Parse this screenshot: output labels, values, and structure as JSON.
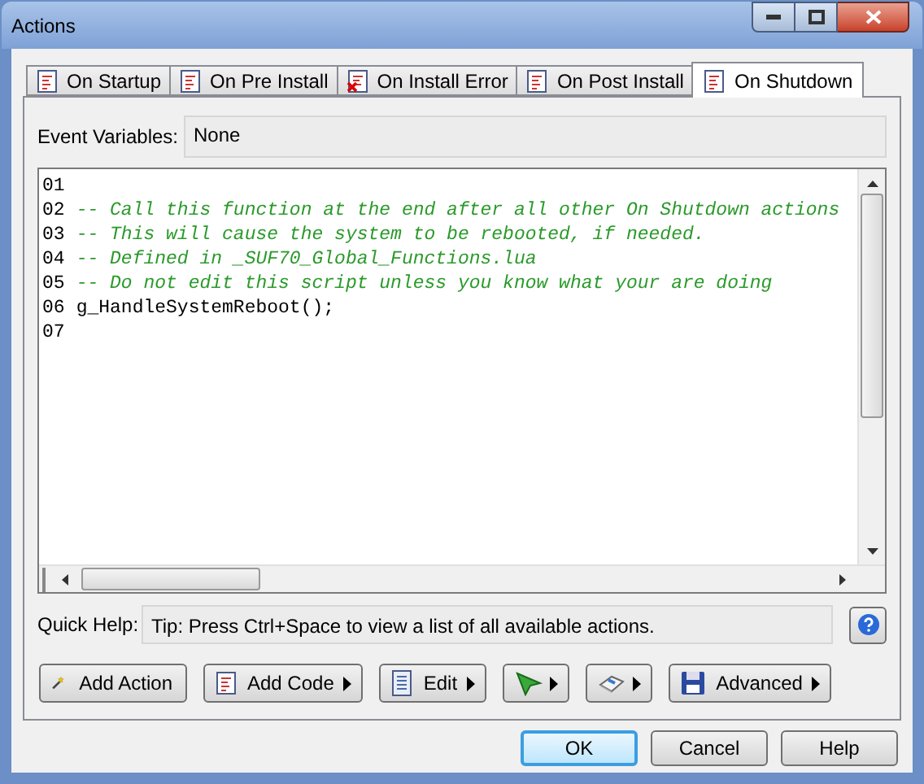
{
  "window": {
    "title": "Actions"
  },
  "tabs": [
    {
      "label": "On Startup",
      "selected": false,
      "kind": "script"
    },
    {
      "label": "On Pre Install",
      "selected": false,
      "kind": "script"
    },
    {
      "label": "On Install Error",
      "selected": false,
      "kind": "error"
    },
    {
      "label": "On Post Install",
      "selected": false,
      "kind": "script"
    },
    {
      "label": "On Shutdown",
      "selected": true,
      "kind": "script"
    }
  ],
  "event_variables": {
    "label": "Event Variables:",
    "value": "None"
  },
  "editor": {
    "lines": [
      {
        "number": "01"
      },
      {
        "number": "02",
        "kind": "comment",
        "text": "-- Call this function at the end after all other On Shutdown actions"
      },
      {
        "number": "03",
        "kind": "comment",
        "text": "-- This will cause the system to be rebooted, if needed."
      },
      {
        "number": "04",
        "kind": "comment",
        "text": "-- Defined in _SUF70_Global_Functions.lua"
      },
      {
        "number": "05",
        "kind": "comment",
        "text": "-- Do not edit this script unless you know what your are doing"
      },
      {
        "number": "06",
        "kind": "code",
        "text": "g_HandleSystemReboot();"
      },
      {
        "number": "07"
      }
    ]
  },
  "quick_help": {
    "label": "Quick Help:",
    "value": "Tip: Press Ctrl+Space to view a list of all available actions."
  },
  "toolbar": [
    {
      "kind": "wand",
      "label": "Add Action",
      "menu": false
    },
    {
      "kind": "script",
      "label": "Add Code",
      "menu": true
    },
    {
      "kind": "page",
      "label": "Edit",
      "menu": true
    },
    {
      "kind": "cursor",
      "menu": true
    },
    {
      "kind": "eraser",
      "menu": true
    },
    {
      "kind": "disk",
      "label": "Advanced",
      "menu": true
    }
  ],
  "dialog_buttons": [
    {
      "label": "OK",
      "default": true
    },
    {
      "label": "Cancel",
      "default": false
    },
    {
      "label": "Help",
      "default": false
    }
  ]
}
